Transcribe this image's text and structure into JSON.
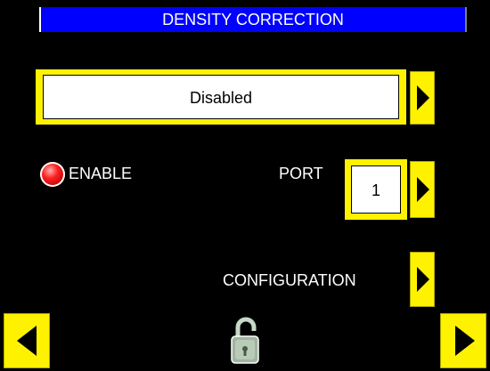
{
  "header": {
    "title": "DENSITY CORRECTION"
  },
  "mode": {
    "value": "Disabled"
  },
  "enable": {
    "label": "ENABLE",
    "indicator_color": "#ff2020"
  },
  "port": {
    "label": "PORT",
    "value": "1"
  },
  "configuration": {
    "label": "CONFIGURATION"
  },
  "nav": {
    "lock_icon": "unlocked-padlock-icon"
  },
  "colors": {
    "title_bar": "#0000ff",
    "button": "#fff200",
    "background": "#000000"
  }
}
